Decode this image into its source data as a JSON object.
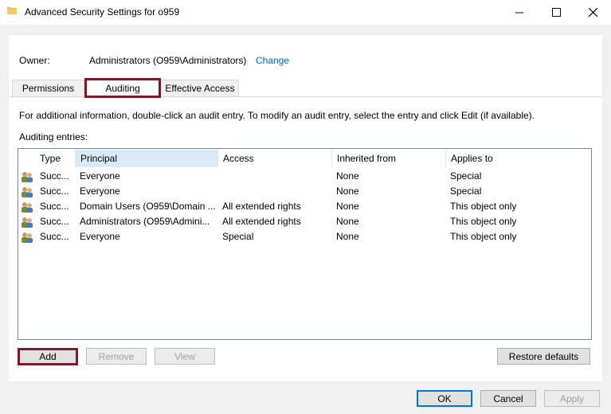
{
  "window": {
    "title": "Advanced Security Settings for o959",
    "icon": "folder-icon"
  },
  "owner": {
    "label": "Owner:",
    "value": "Administrators (O959\\Administrators)",
    "change_link": "Change"
  },
  "tabs": [
    {
      "label": "Permissions",
      "selected": false
    },
    {
      "label": "Auditing",
      "selected": true
    },
    {
      "label": "Effective Access",
      "selected": false
    }
  ],
  "info_text": "For additional information, double-click an audit entry. To modify an audit entry, select the entry and click Edit (if available).",
  "entries_label": "Auditing entries:",
  "table": {
    "columns": [
      "Type",
      "Principal",
      "Access",
      "Inherited from",
      "Applies to"
    ],
    "rows": [
      [
        "Succ...",
        "Everyone",
        "",
        "None",
        "Special"
      ],
      [
        "Succ...",
        "Everyone",
        "",
        "None",
        "Special"
      ],
      [
        "Succ...",
        "Domain Users (O959\\Domain ...",
        "All extended rights",
        "None",
        "This object only"
      ],
      [
        "Succ...",
        "Administrators (O959\\Admini...",
        "All extended rights",
        "None",
        "This object only"
      ],
      [
        "Succ...",
        "Everyone",
        "Special",
        "None",
        "This object only"
      ]
    ]
  },
  "buttons": {
    "add": "Add",
    "remove": "Remove",
    "view": "View",
    "restore": "Restore defaults",
    "ok": "OK",
    "cancel": "Cancel",
    "apply": "Apply"
  },
  "colors": {
    "highlight_box": "#7b1c2a",
    "link": "#0066cc",
    "selected_header": "#d9ebf9",
    "ok_border": "#0078d7"
  }
}
